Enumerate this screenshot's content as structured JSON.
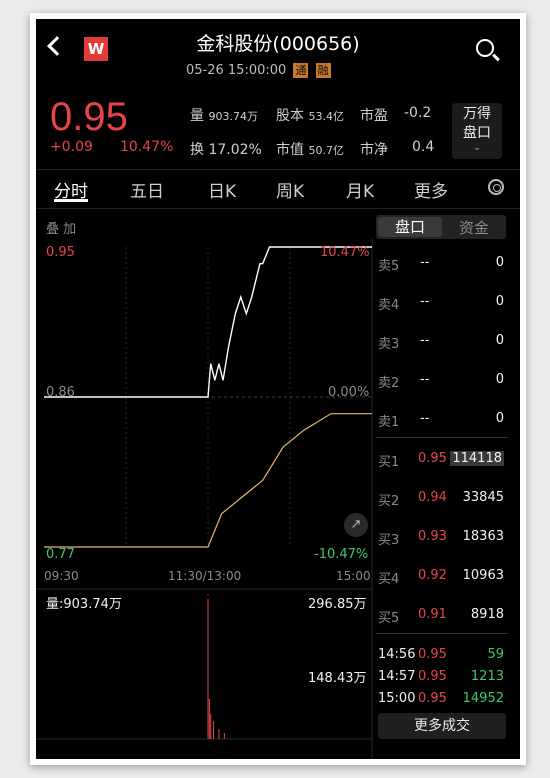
{
  "header": {
    "title": "金科股份(000656)",
    "datetime": "05-26 15:00:00",
    "tag_tong": "通",
    "tag_rong": "融",
    "logo_letter": "W"
  },
  "quote": {
    "price": "0.95",
    "change": "+0.09",
    "change_pct": "10.47%",
    "stats": [
      {
        "label": "量",
        "value": "903.74万"
      },
      {
        "label": "股本",
        "value": "53.4亿"
      },
      {
        "label": "市盈",
        "value": "-0.2"
      },
      {
        "label": "换",
        "value": "17.02%"
      },
      {
        "label": "市值",
        "value": "50.7亿"
      },
      {
        "label": "市净",
        "value": "0.4"
      }
    ],
    "wande_line1": "万得",
    "wande_line2": "盘口"
  },
  "tabs": [
    "分时",
    "五日",
    "日K",
    "周K",
    "月K",
    "更多"
  ],
  "chart": {
    "overlay_label": "叠 加",
    "y_top": "0.95",
    "y_mid": "0.86",
    "y_bottom": "0.77",
    "pct_top": "10.47%",
    "pct_mid": "0.00%",
    "pct_bottom": "-10.47%",
    "x_start": "09:30",
    "x_mid": "11:30/13:00",
    "x_end": "15:00",
    "volume_label": "量:903.74万",
    "vol_max": "296.85万",
    "vol_mid": "148.43万",
    "line_color": "#ffffff",
    "avg_color": "#e6b86a"
  },
  "chart_data": {
    "type": "line",
    "title": "",
    "xlabel": "",
    "ylabel": "",
    "ylim": [
      0.77,
      0.95
    ],
    "x_ticks": [
      "09:30",
      "11:30/13:00",
      "15:00"
    ],
    "series": [
      {
        "x_minutes": [
          0,
          120,
          122,
          125,
          128,
          131,
          135,
          140,
          144,
          148,
          152,
          155,
          158,
          160,
          165,
          170,
          175,
          180,
          185,
          190,
          200,
          210,
          240
        ],
        "values": [
          0.86,
          0.86,
          0.88,
          0.87,
          0.88,
          0.87,
          0.89,
          0.91,
          0.92,
          0.91,
          0.92,
          0.93,
          0.94,
          0.94,
          0.95,
          0.95,
          0.95,
          0.95,
          0.95,
          0.95,
          0.95,
          0.95,
          0.95
        ]
      },
      {
        "x_minutes": [
          0,
          120,
          130,
          145,
          160,
          175,
          190,
          210,
          240
        ],
        "values": [
          0.77,
          0.77,
          0.79,
          0.8,
          0.81,
          0.83,
          0.84,
          0.85,
          0.85
        ]
      }
    ]
  },
  "orderbook": {
    "tab_pankou": "盘口",
    "tab_zijin": "资金",
    "asks": [
      {
        "label": "卖5",
        "price": "--",
        "vol": "0"
      },
      {
        "label": "卖4",
        "price": "--",
        "vol": "0"
      },
      {
        "label": "卖3",
        "price": "--",
        "vol": "0"
      },
      {
        "label": "卖2",
        "price": "--",
        "vol": "0"
      },
      {
        "label": "卖1",
        "price": "--",
        "vol": "0"
      }
    ],
    "bids": [
      {
        "label": "买1",
        "price": "0.95",
        "vol": "114118"
      },
      {
        "label": "买2",
        "price": "0.94",
        "vol": "33845"
      },
      {
        "label": "买3",
        "price": "0.93",
        "vol": "18363"
      },
      {
        "label": "买4",
        "price": "0.92",
        "vol": "10963"
      },
      {
        "label": "买5",
        "price": "0.91",
        "vol": "8918"
      }
    ],
    "trades": [
      {
        "time": "14:56",
        "price": "0.95",
        "vol": "59"
      },
      {
        "time": "14:57",
        "price": "0.95",
        "vol": "1213"
      },
      {
        "time": "15:00",
        "price": "0.95",
        "vol": "14952"
      }
    ],
    "more_trades": "更多成交"
  }
}
